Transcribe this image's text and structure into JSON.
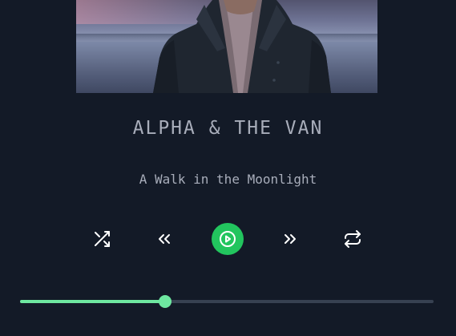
{
  "album": {
    "cover_alt": "Album cover: person in dark jacket standing by a lake at dusk"
  },
  "track": {
    "artist": "ALPHA & THE VAN",
    "title": "A Walk in the Moonlight"
  },
  "controls": {
    "shuffle_icon": "shuffle-icon",
    "previous_icon": "double-chevron-left-icon",
    "play_icon": "play-circle-icon",
    "next_icon": "double-chevron-right-icon",
    "repeat_icon": "repeat-icon"
  },
  "progress": {
    "fraction": 0.35
  },
  "colors": {
    "background": "#131a27",
    "text": "#a8adba",
    "accent": "#22c55e",
    "progress_fill": "#6ee7a0",
    "progress_track": "#374151"
  }
}
